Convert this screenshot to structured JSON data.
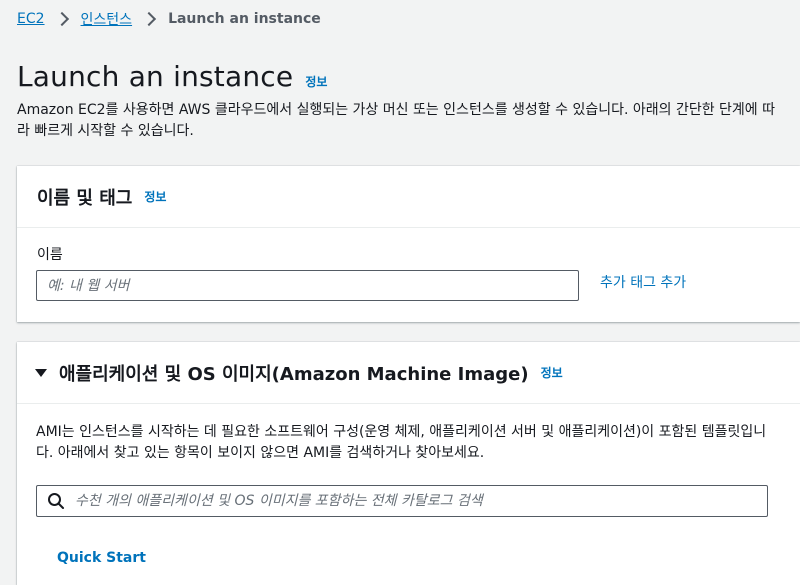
{
  "breadcrumb": {
    "items": [
      {
        "label": "EC2"
      },
      {
        "label": "인스턴스"
      }
    ],
    "current": "Launch an instance"
  },
  "header": {
    "title": "Launch an instance",
    "info": "정보",
    "description": "Amazon EC2를 사용하면 AWS 클라우드에서 실행되는 가상 머신 또는 인스턴스를 생성할 수 있습니다. 아래의 간단한 단계에 따라 빠르게 시작할 수 있습니다."
  },
  "name_panel": {
    "title": "이름 및 태그",
    "info": "정보",
    "field_label": "이름",
    "input_placeholder": "예: 내 웹 서버",
    "input_value": "",
    "add_tag_label": "추가 태그 추가"
  },
  "ami_panel": {
    "title": "애플리케이션 및 OS 이미지(Amazon Machine Image)",
    "info": "정보",
    "description": "AMI는 인스턴스를 시작하는 데 필요한 소프트웨어 구성(운영 체제, 애플리케이션 서버 및 애플리케이션)이 포함된 템플릿입니다. 아래에서 찾고 있는 항목이 보이지 않으면 AMI를 검색하거나 찾아보세요.",
    "search_placeholder": "수천 개의 애플리케이션 및 OS 이미지를 포함하는 전체 카탈로그 검색",
    "quick_start_label": "Quick Start"
  },
  "colors": {
    "link": "#0073bb",
    "text": "#16191f",
    "background": "#f2f3f3"
  }
}
